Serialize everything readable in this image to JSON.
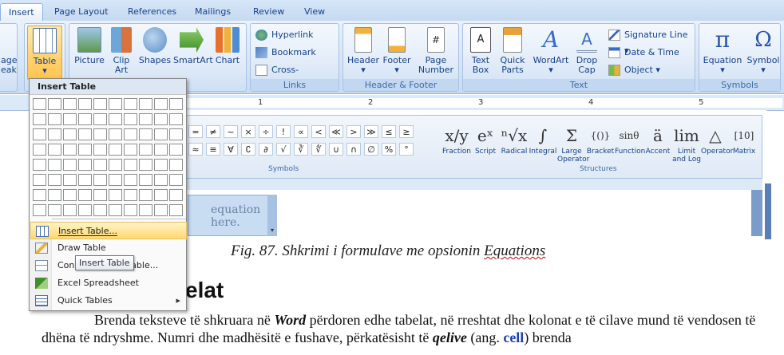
{
  "tabs": [
    "Insert",
    "Page Layout",
    "References",
    "Mailings",
    "Review",
    "View"
  ],
  "active_tab": "Insert",
  "ribbon": {
    "partial_left": [
      "age",
      "eak"
    ],
    "table_label": "Table",
    "illustrations": [
      "Picture",
      "Clip Art",
      "Shapes",
      "SmartArt",
      "Chart"
    ],
    "links": {
      "hyperlink": "Hyperlink",
      "bookmark": "Bookmark",
      "crossref": "Cross-reference",
      "group": "Links"
    },
    "header_footer": {
      "header": "Header",
      "footer": "Footer",
      "page_number_1": "Page",
      "page_number_2": "Number",
      "group": "Header & Footer"
    },
    "text": {
      "textbox_1": "Text",
      "textbox_2": "Box",
      "quickparts_1": "Quick",
      "quickparts_2": "Parts",
      "wordart": "WordArt",
      "dropcap_1": "Drop",
      "dropcap_2": "Cap",
      "signature": "Signature Line",
      "datetime": "Date & Time",
      "object": "Object",
      "group": "Text"
    },
    "symbols": {
      "equation": "Equation",
      "symbol": "Symbol",
      "group": "Symbols"
    }
  },
  "ruler_numbers": [
    "1",
    "2",
    "3",
    "4",
    "5",
    "6"
  ],
  "equation_tools": {
    "symbols_row1": [
      "=",
      "≠",
      "~",
      "×",
      "÷",
      "!",
      "∝",
      "<",
      "≪",
      ">",
      "≫",
      "≤",
      "≥"
    ],
    "symbols_row2": [
      "≈",
      "≡",
      "∀",
      "∁",
      "∂",
      "√",
      "∛",
      "∜",
      "∪",
      "∩",
      "∅",
      "%",
      "°"
    ],
    "symbols_group": "Symbols",
    "structures": [
      {
        "glyph": "x/y",
        "label": "Fraction"
      },
      {
        "glyph": "eˣ",
        "label": "Script"
      },
      {
        "glyph": "ⁿ√x",
        "label": "Radical"
      },
      {
        "glyph": "∫",
        "label": "Integral"
      },
      {
        "glyph": "Σ",
        "label": "Large Operator"
      },
      {
        "glyph": "{()}",
        "label": "Bracket"
      },
      {
        "glyph": "sinθ",
        "label": "Function"
      },
      {
        "glyph": "ä",
        "label": "Accent"
      },
      {
        "glyph": "lim",
        "label": "Limit and Log"
      },
      {
        "glyph": "△",
        "label": "Operator"
      },
      {
        "glyph": "[10]",
        "label": "Matrix"
      }
    ],
    "structures_group": "Structures",
    "placeholder": "equation here."
  },
  "insert_table_menu": {
    "header": "Insert Table",
    "grid_cols": 10,
    "grid_rows": 8,
    "items": [
      {
        "label": "Insert Table...",
        "highlighted": true
      },
      {
        "label": "Draw Table",
        "highlighted": false
      },
      {
        "label": "Convert Text to Table...",
        "highlighted": false
      },
      {
        "label": "Excel Spreadsheet",
        "highlighted": false
      },
      {
        "label": "Quick Tables",
        "highlighted": false,
        "submenu": true
      }
    ],
    "tooltip": "Insert Table"
  },
  "document": {
    "caption_prefix": "Fig. 87. Shkrimi i formulave me opsionin ",
    "caption_word": "Equations",
    "heading_partial": "elat",
    "paragraph": {
      "p1": "Brenda teksteve të shkruara në ",
      "b1": "Word",
      "p2": " përdoren edhe tabelat, në rreshtat dhe kolonat e të cilave mund të vendosen të dhëna të ndryshme. Numri dhe madhësitë e fushave, përkatësisht të ",
      "b2": "qelive",
      "p3": " (ang. ",
      "b3": "cell",
      "p4": ") brenda"
    }
  }
}
